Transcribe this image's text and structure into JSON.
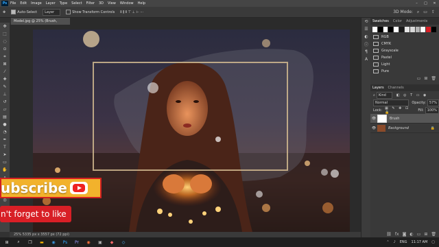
{
  "menubar": {
    "logo": "Ps",
    "items": [
      "File",
      "Edit",
      "Image",
      "Layer",
      "Type",
      "Select",
      "Filter",
      "3D",
      "View",
      "Window",
      "Help"
    ],
    "window_controls": [
      "–",
      "□",
      "✕"
    ]
  },
  "options": {
    "auto_select": "Auto-Select",
    "target": "Layer",
    "show_transform": "Show Transform Controls",
    "mode_3d": "3D Mode:"
  },
  "document": {
    "tab": "Model.jpg @ 25% (Brush, RGB/8) *",
    "status": "25%    5335 px x 3557 px (72 ppi)"
  },
  "swatches": {
    "tabs": [
      "Swatches",
      "Color",
      "Adjustments"
    ],
    "colors": [
      "#ffffff",
      "#000000",
      "#ffffff",
      "#000000",
      "#ffffff",
      "#1a1a1a",
      "#e5e5e5",
      "#d9d9d9",
      "#b3b3b3",
      "#ffffff",
      "#d61f26",
      "#000000"
    ],
    "groups": [
      "RGB",
      "CMYK",
      "Grayscale",
      "Pastel",
      "Light",
      "Pure"
    ]
  },
  "layers": {
    "tabs": [
      "Layers",
      "Channels"
    ],
    "filter": "Kind",
    "blend_mode": "Normal",
    "opacity_label": "Opacity:",
    "opacity_value": "57%",
    "lock_label": "Lock:",
    "fill_label": "Fill:",
    "fill_value": "100%",
    "rows": [
      {
        "name": "Brush",
        "selected": true
      },
      {
        "name": "Background",
        "selected": false
      }
    ]
  },
  "overlay": {
    "subscribe": "ubscribe",
    "reminder": "n't forget to like"
  },
  "taskbar": {
    "lang": "ENG",
    "time": "11:17 AM"
  }
}
